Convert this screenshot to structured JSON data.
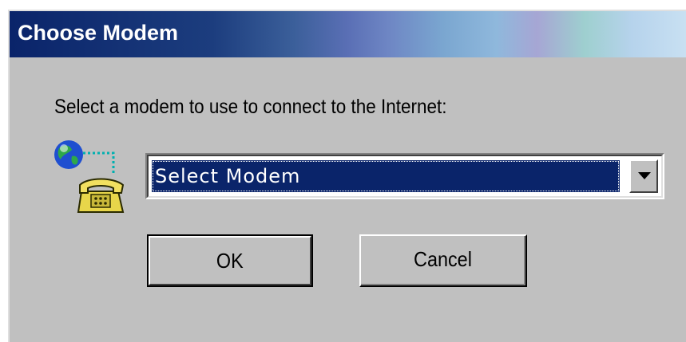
{
  "window": {
    "title": "Choose Modem"
  },
  "dialog": {
    "prompt": "Select a modem to use to connect to the Internet:",
    "modem_select": {
      "selected_value": "Select Modem"
    },
    "buttons": {
      "ok_label": "OK",
      "cancel_label": "Cancel"
    },
    "icons": {
      "modem": "globe-telephone-icon",
      "dropdown": "chevron-down-icon"
    }
  },
  "colors": {
    "dialog_face": "#c0c0c0",
    "selection_highlight": "#0a246a",
    "title_start": "#0a246a"
  }
}
